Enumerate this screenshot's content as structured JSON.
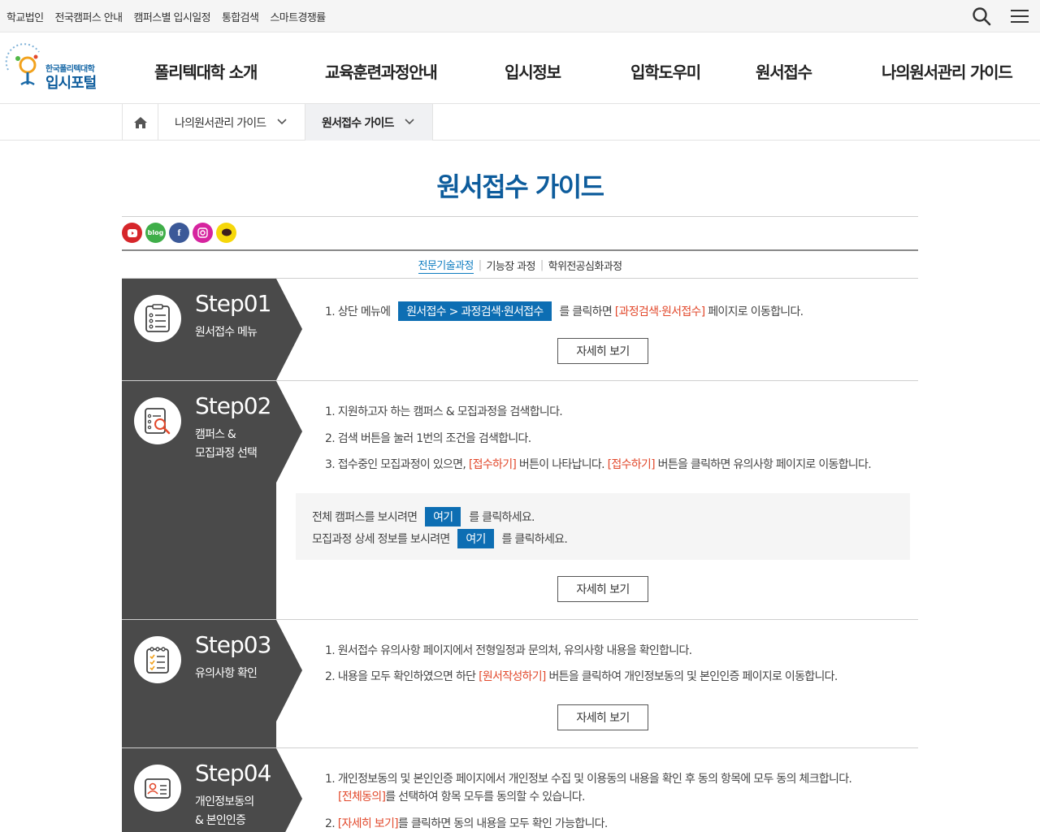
{
  "topbar": {
    "links": [
      "학교법인",
      "전국캠퍼스 안내",
      "캠퍼스별 입시일정",
      "통합검색",
      "스마트경쟁률"
    ]
  },
  "logo": {
    "small": "한국폴리텍대학",
    "big": "입시포털"
  },
  "gnb": [
    "폴리텍대학 소개",
    "교육훈련과정안내",
    "입시정보",
    "입학도우미",
    "원서접수",
    "나의원서관리 가이드"
  ],
  "breadcrumb": {
    "level1": "나의원서관리 가이드",
    "level2": "원서접수 가이드"
  },
  "page": {
    "title": "원서접수 가이드"
  },
  "sns": {
    "blog_label": "blog"
  },
  "tabs": [
    "전문기술과정",
    "기능장 과정",
    "학위전공심화과정"
  ],
  "detail_label": "자세히 보기",
  "steps": [
    {
      "num": "Step01",
      "sub": "원서접수 메뉴",
      "line1_a": "1. 상단 메뉴에",
      "line1_chip": "원서접수 > 과정검색·원서접수",
      "line1_b": "를 클릭하면",
      "line1_hl": "[과정검색·원서접수]",
      "line1_c": "페이지로 이동합니다."
    },
    {
      "num": "Step02",
      "sub": "캠퍼스 &\n모집과정 선택",
      "line1": "1. 지원하고자 하는 캠퍼스 & 모집과정을 검색합니다.",
      "line2": "2. 검색 버튼을 눌러 1번의 조건을 검색합니다.",
      "line3_a": "3. 접수중인 모집과정이 있으면,",
      "line3_hl1": "[접수하기]",
      "line3_b": "버튼이 나타납니다.",
      "line3_hl2": "[접수하기]",
      "line3_c": "버튼을 클릭하면 유의사항 페이지로 이동합니다.",
      "box1_a": "전체 캠퍼스를 보시려면",
      "box1_chip": "여기",
      "box1_b": "를 클릭하세요.",
      "box2_a": "모집과정 상세 정보를 보시려면",
      "box2_chip": "여기",
      "box2_b": "를 클릭하세요."
    },
    {
      "num": "Step03",
      "sub": "유의사항 확인",
      "line1": "1. 원서접수 유의사항 페이지에서 전형일정과 문의처, 유의사항 내용을 확인합니다.",
      "line2_a": "2. 내용을 모두 확인하였으면 하단",
      "line2_hl": "[원서작성하기]",
      "line2_b": "버튼을 클릭하여 개인정보동의 및 본인인증 페이지로 이동합니다."
    },
    {
      "num": "Step04",
      "sub": "개인정보동의\n& 본인인증",
      "line1": "1. 개인정보동의 및 본인인증 페이지에서 개인정보 수집 및 이용동의 내용을 확인 후 동의 항목에 모두 동의 체크합니다.",
      "line1b_hl": "[전체동의]",
      "line1b": "를 선택하여 항목 모두를 동의할 수 있습니다.",
      "line2_hl": "[자세히 보기]",
      "line2": "를 클릭하면 동의 내용을 모두 확인 가능합니다."
    }
  ],
  "colors": {
    "brand": "#0d5c9c",
    "chip": "#0d6eb3",
    "highlight": "#e2492c",
    "step_bg": "#4a4a4a"
  }
}
